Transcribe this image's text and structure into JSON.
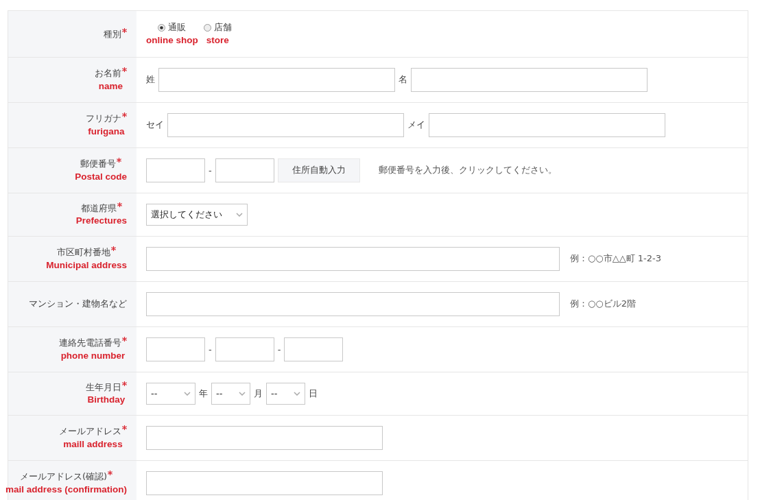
{
  "rows": [
    {
      "label": "種別",
      "required": true,
      "items": [
        {
          "kind": "radio",
          "label": "通販",
          "note": "online shop",
          "selected": true
        },
        {
          "kind": "radio",
          "label": "店舗",
          "note": "store",
          "selected": false
        }
      ]
    },
    {
      "label": "お名前",
      "required": true,
      "english": "name",
      "items": [
        {
          "kind": "text",
          "text": "姓"
        },
        {
          "kind": "input-m"
        },
        {
          "kind": "text",
          "text": "名"
        },
        {
          "kind": "input-m"
        }
      ]
    },
    {
      "label": "フリガナ",
      "required": true,
      "english": "furigana",
      "items": [
        {
          "kind": "text",
          "text": "セイ"
        },
        {
          "kind": "input-m"
        },
        {
          "kind": "text",
          "text": "メイ"
        },
        {
          "kind": "input-m"
        }
      ]
    },
    {
      "label": "郵便番号",
      "required": true,
      "english": "Postal code",
      "items": [
        {
          "kind": "input-s"
        },
        {
          "kind": "text",
          "text": "-"
        },
        {
          "kind": "input-s"
        },
        {
          "kind": "button",
          "text": "住所自動入力"
        },
        {
          "kind": "note",
          "text": "郵便番号を入力後、クリックしてください。"
        }
      ]
    },
    {
      "label": "都道府県",
      "required": true,
      "english": "Prefectures",
      "items": [
        {
          "kind": "select-l",
          "value": "選択してください"
        }
      ]
    },
    {
      "label": "市区町村番地",
      "required": true,
      "english": "Municipal address",
      "items": [
        {
          "kind": "input-l"
        },
        {
          "kind": "note",
          "text": "例：○○市△△町 1-2-3"
        }
      ]
    },
    {
      "label": "マンション・建物名など",
      "required": false,
      "items": [
        {
          "kind": "input-l"
        },
        {
          "kind": "note",
          "text": "例：○○ビル2階"
        }
      ]
    },
    {
      "label": "連絡先電話番号",
      "required": true,
      "english": "phone number",
      "items": [
        {
          "kind": "input-s"
        },
        {
          "kind": "text",
          "text": "-"
        },
        {
          "kind": "input-s"
        },
        {
          "kind": "text",
          "text": "-"
        },
        {
          "kind": "input-s"
        }
      ]
    },
    {
      "label": "生年月日",
      "required": true,
      "english": "Birthday",
      "items": [
        {
          "kind": "select-m",
          "value": "--"
        },
        {
          "kind": "text",
          "text": "年"
        },
        {
          "kind": "select-s",
          "value": "--"
        },
        {
          "kind": "text",
          "text": "月"
        },
        {
          "kind": "select-s",
          "value": "--"
        },
        {
          "kind": "text",
          "text": "日"
        }
      ]
    },
    {
      "label": "メールアドレス",
      "required": true,
      "english": "maill address",
      "items": [
        {
          "kind": "input-m"
        }
      ]
    },
    {
      "label": "メールアドレス(確認)",
      "required": true,
      "english": "mail address (confirmation)",
      "items": [
        {
          "kind": "input-m"
        }
      ]
    }
  ]
}
